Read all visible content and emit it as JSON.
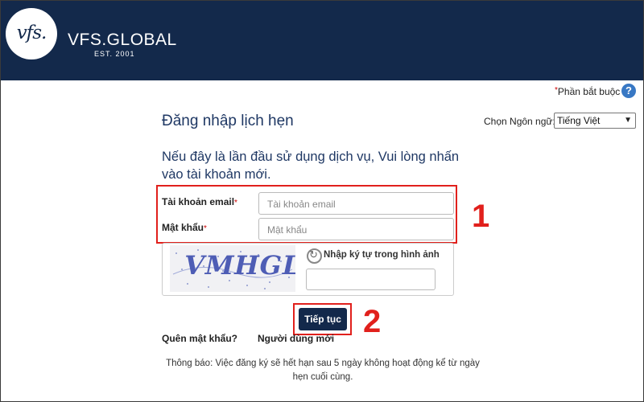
{
  "header": {
    "logo_text": "vfs.",
    "brand": "VFS.GLOBAL",
    "tagline": "EST. 2001",
    "color": "#13294b"
  },
  "required_note": {
    "star": "*",
    "text": "Phần bắt buộc"
  },
  "help_icon": {
    "glyph": "?",
    "icon": "help-icon"
  },
  "title": "Đăng nhập lịch hẹn",
  "language": {
    "label": "Chọn Ngôn ngữ:",
    "selected": "Tiếng Việt"
  },
  "intro": "Nếu đây là lần đầu sử dụng dịch vụ, Vui lòng nhấn vào tài khoản mới.",
  "form": {
    "email_label": "Tài khoản email",
    "email_placeholder": "Tài khoản email",
    "password_label": "Mật khẩu",
    "password_placeholder": "Mật khẩu",
    "required_star": "*"
  },
  "captcha": {
    "image_text": "VMHGL",
    "label": "Nhập ký tự trong hình ảnh",
    "value": ""
  },
  "submit_label": "Tiếp tục",
  "annotations": {
    "marker1": "1",
    "marker2": "2",
    "accent": "#e1201c"
  },
  "links": {
    "forgot": "Quên mật khẩu?",
    "new_user": "Người dùng mới"
  },
  "notice": "Thông báo: Việc đăng ký sẽ hết hạn sau 5 ngày không hoạt động kể từ ngày hẹn cuối cùng."
}
